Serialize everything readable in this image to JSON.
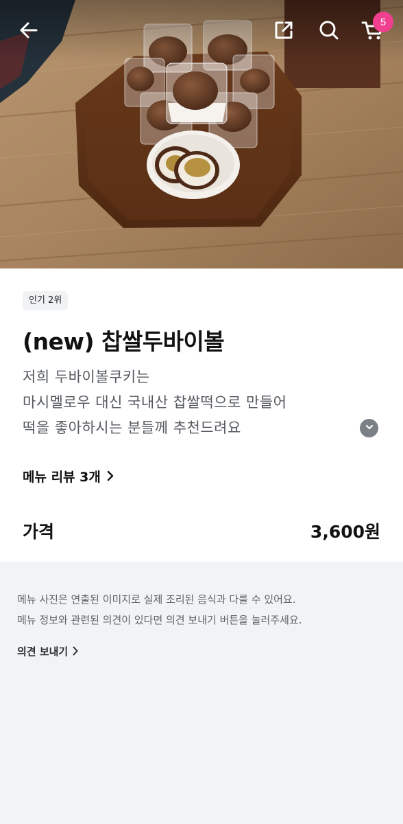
{
  "header": {
    "back_icon": "arrow-left-icon",
    "share_icon": "share-icon",
    "search_icon": "search-icon",
    "cart_icon": "cart-icon",
    "cart_count": "5"
  },
  "hero": {
    "image_subject": "chocolate rice cakes on wooden tray"
  },
  "product": {
    "badge": "인기 2위",
    "title": "(new) 찹쌀두바이볼",
    "description": [
      "저희 두바이볼쿠키는",
      "마시멜로우 대신 국내산 찹쌀떡으로 만들어",
      "떡을 좋아하시는 분들께 추천드려요"
    ],
    "expand_icon": "chevron-down-icon",
    "review_link": "메뉴 리뷰 3개",
    "price_label": "가격",
    "price": "3,600원"
  },
  "notice": {
    "lines": [
      "메뉴 사진은 연출된 이미지로 실제 조리된 음식과 다를 수 있어요.",
      "메뉴 정보와 관련된 의견이 있다면 의견 보내기 버튼을 눌러주세요."
    ],
    "feedback_link": "의견 보내기"
  },
  "colors": {
    "cart_badge": "#f0408f",
    "page_background": "#f2f3f5",
    "card_background": "#ffffff"
  }
}
